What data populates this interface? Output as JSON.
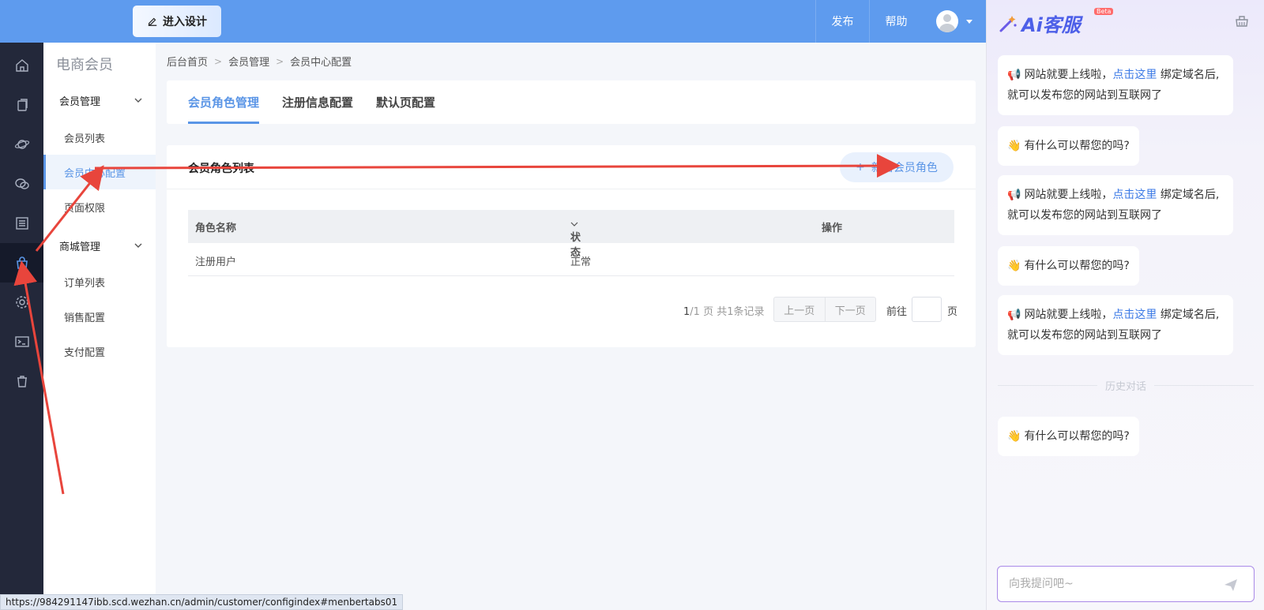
{
  "topbar": {
    "design_label": "进入设计",
    "publish_label": "发布",
    "help_label": "帮助"
  },
  "iconbar": {
    "icons": [
      "home-icon",
      "copy-icon",
      "planet-icon",
      "wechat-icon",
      "list-icon",
      "shop-bag-icon",
      "gear-icon",
      "terminal-icon",
      "trash-icon"
    ],
    "active": "shop-bag-icon"
  },
  "submenu": {
    "title": "电商会员",
    "groups": [
      {
        "label": "会员管理",
        "items": [
          "会员列表",
          "会员中心配置",
          "页面权限"
        ]
      },
      {
        "label": "商城管理",
        "items": [
          "订单列表",
          "销售配置",
          "支付配置"
        ]
      }
    ],
    "active_item": "会员中心配置"
  },
  "breadcrumb": [
    "后台首页",
    "会员管理",
    "会员中心配置"
  ],
  "tabs": [
    {
      "label": "会员角色管理",
      "active": true
    },
    {
      "label": "注册信息配置",
      "active": false
    },
    {
      "label": "默认页配置",
      "active": false
    }
  ],
  "list": {
    "title": "会员角色列表",
    "add_button": "新增会员角色",
    "columns": [
      "角色名称",
      "状态",
      "操作"
    ],
    "rows": [
      {
        "name": "注册用户",
        "status": "正常",
        "action": ""
      }
    ]
  },
  "pager": {
    "current": "1",
    "total_text": "/1 页 共1条记录",
    "prev": "上一页",
    "next": "下一页",
    "goto": "前往",
    "page_unit": "页"
  },
  "statusbar_url": "https://984291147ibb.scd.wezhan.cn/admin/customer/configindex#menbertabs01",
  "chat": {
    "logo": "Ai客服",
    "beta": "Beta",
    "msg_launch_prefix": "网站就要上线啦，",
    "msg_launch_link": "点击这里",
    "msg_launch_suffix": "绑定域名后,就可以发布您的网站到互联网了",
    "msg_help": "有什么可以帮您的吗?",
    "history_divider": "历史对话",
    "input_placeholder": "向我提问吧~"
  },
  "colors": {
    "topbar": "#5e9bee",
    "accent": "#5a95e6",
    "sidebar_dark": "#23283a",
    "annotation": "#e8453c"
  }
}
